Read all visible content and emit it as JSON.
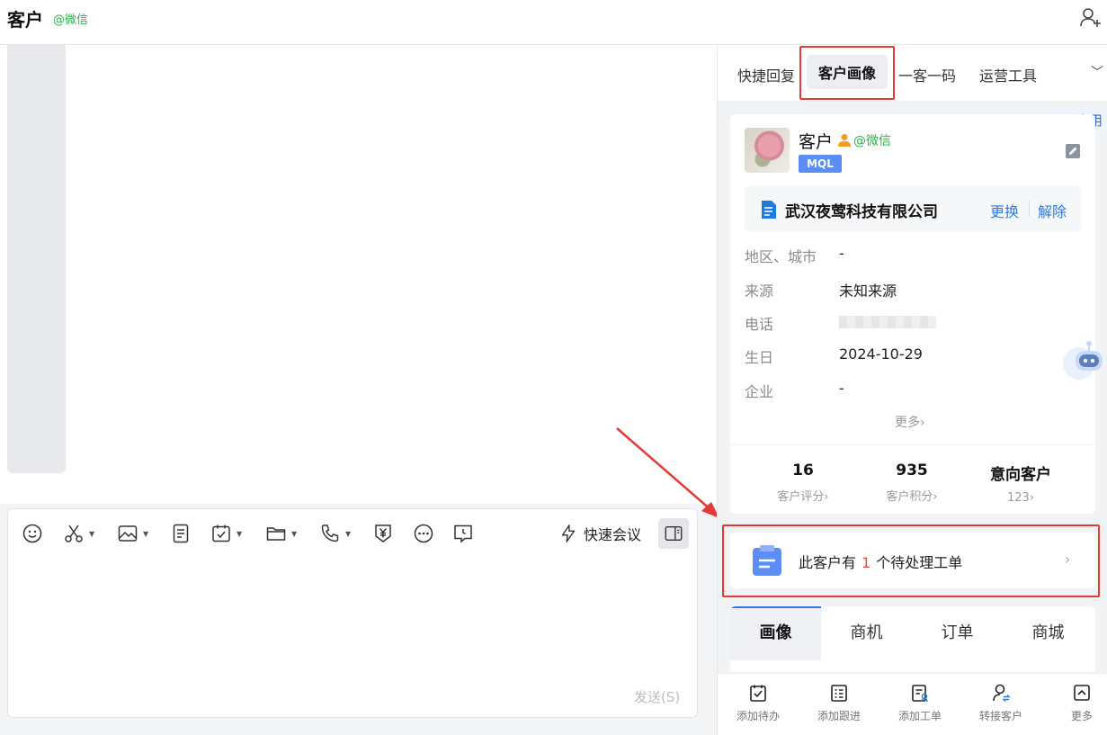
{
  "header": {
    "title": "客户",
    "source_tag": "@微信"
  },
  "composer": {
    "quick_meeting_label": "快速会议",
    "send_label": "发送(S)"
  },
  "right_panel": {
    "tabs": [
      {
        "label": "快捷回复"
      },
      {
        "label": "客户画像"
      },
      {
        "label": "一客一码"
      },
      {
        "label": "运营工具"
      }
    ],
    "active_tab": "客户画像",
    "app_button_label": "应用",
    "customer": {
      "name": "客户",
      "source_tag": "@微信",
      "stage_badge": "MQL",
      "company": {
        "name": "武汉夜莺科技有限公司",
        "switch_label": "更换",
        "remove_label": "解除"
      },
      "fields": [
        {
          "key": "地区、城市",
          "value": "-"
        },
        {
          "key": "来源",
          "value": "未知来源"
        },
        {
          "key": "电话",
          "value": ""
        },
        {
          "key": "生日",
          "value": "2024-10-29"
        },
        {
          "key": "企业",
          "value": "-"
        }
      ],
      "more_label": "更多",
      "stats": [
        {
          "value": "16",
          "label": "客户评分"
        },
        {
          "value": "935",
          "label": "客户积分"
        },
        {
          "value": "意向客户",
          "label": "123"
        }
      ]
    },
    "ticket": {
      "prefix": "此客户有",
      "count": "1",
      "suffix": "个待处理工单"
    },
    "sub_tabs": [
      {
        "label": "画像"
      },
      {
        "label": "商机"
      },
      {
        "label": "订单"
      },
      {
        "label": "商城"
      }
    ],
    "active_sub_tab": "画像",
    "bottom_actions": [
      {
        "label": "添加待办",
        "icon": "todo-icon"
      },
      {
        "label": "添加跟进",
        "icon": "followup-icon"
      },
      {
        "label": "添加工单",
        "icon": "ticket-icon"
      },
      {
        "label": "转接客户",
        "icon": "transfer-icon"
      },
      {
        "label": "更多",
        "icon": "more-icon"
      }
    ]
  },
  "colors": {
    "accent": "#2f7bd9",
    "wechat_green": "#2bb24c",
    "annotation_red": "#e53935",
    "badge_blue": "#5b8ef5"
  }
}
